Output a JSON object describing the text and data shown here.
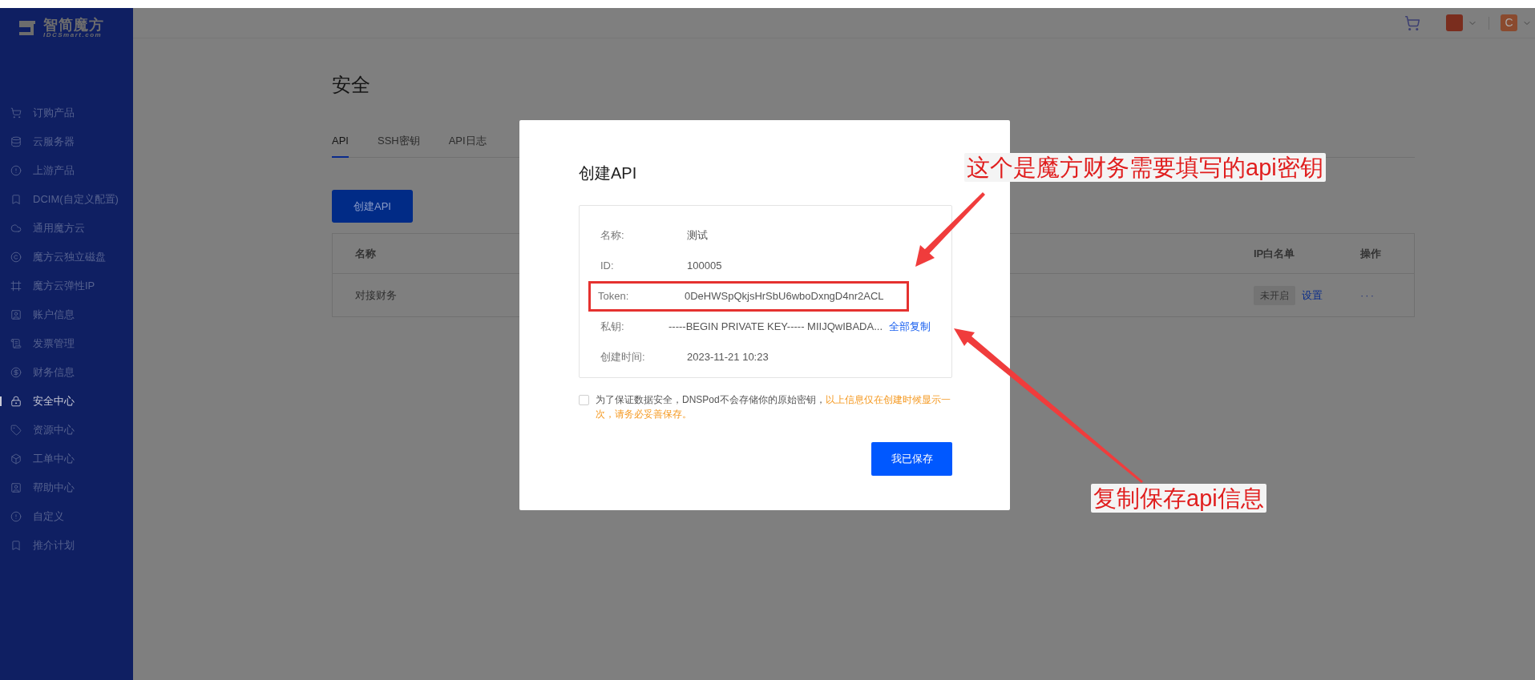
{
  "sidebar": {
    "logo": {
      "name": "智简魔方",
      "domain": "IDCSmart.com"
    },
    "items": [
      {
        "label": "订购产品",
        "selected": false
      },
      {
        "label": "云服务器",
        "selected": false
      },
      {
        "label": "上游产品",
        "selected": false
      },
      {
        "label": "DCIM(自定义配置)",
        "selected": false
      },
      {
        "label": "通用魔方云",
        "selected": false
      },
      {
        "label": "魔方云独立磁盘",
        "selected": false
      },
      {
        "label": "魔方云弹性IP",
        "selected": false
      },
      {
        "label": "账户信息",
        "selected": false
      },
      {
        "label": "发票管理",
        "selected": false
      },
      {
        "label": "财务信息",
        "selected": false
      },
      {
        "label": "安全中心",
        "selected": true
      },
      {
        "label": "资源中心",
        "selected": false
      },
      {
        "label": "工单中心",
        "selected": false
      },
      {
        "label": "帮助中心",
        "selected": false
      },
      {
        "label": "自定义",
        "selected": false
      },
      {
        "label": "推介计划",
        "selected": false
      }
    ]
  },
  "header": {
    "avatars": [
      {
        "color": "#7a2d1e"
      },
      {
        "letter": "C",
        "color": "#8a4a2e"
      }
    ]
  },
  "page": {
    "title": "安全",
    "tabs": [
      {
        "label": "API",
        "selected": true
      },
      {
        "label": "SSH密钥",
        "selected": false
      },
      {
        "label": "API日志",
        "selected": false
      }
    ],
    "create_button": "创建API",
    "table": {
      "columns": [
        "名称",
        "IP白名单",
        "操作"
      ],
      "rows": [
        {
          "name": "对接财务",
          "ip_status": "未开启",
          "ip_action": "设置",
          "more": "···"
        }
      ]
    }
  },
  "modal": {
    "title": "创建API",
    "rows": [
      {
        "label": "名称:",
        "value": "测试",
        "highlighted": false
      },
      {
        "label": "ID:",
        "value": "100005",
        "highlighted": false
      },
      {
        "label": "Token:",
        "value": "0DeHWSpQkjsHrSbU6wboDxngD4nr2ACL",
        "highlighted": true
      },
      {
        "label": "私钥:",
        "value": "-----BEGIN PRIVATE KEY----- MIIJQwIBADA...",
        "link": "全部复制",
        "highlighted": false
      },
      {
        "label": "创建时间:",
        "value": "2023-11-21 10:23",
        "highlighted": false
      }
    ],
    "notice": {
      "checked": false,
      "text": "为了保证数据安全，DNSPod不会存储你的原始密钥，",
      "warning": "以上信息仅在创建时候显示一次，请务必妥善保存。"
    },
    "save_button": "我已保存"
  },
  "annotations": [
    {
      "text": "这个是魔方财务需要填写的api密钥"
    },
    {
      "text": "复制保存api信息"
    }
  ]
}
